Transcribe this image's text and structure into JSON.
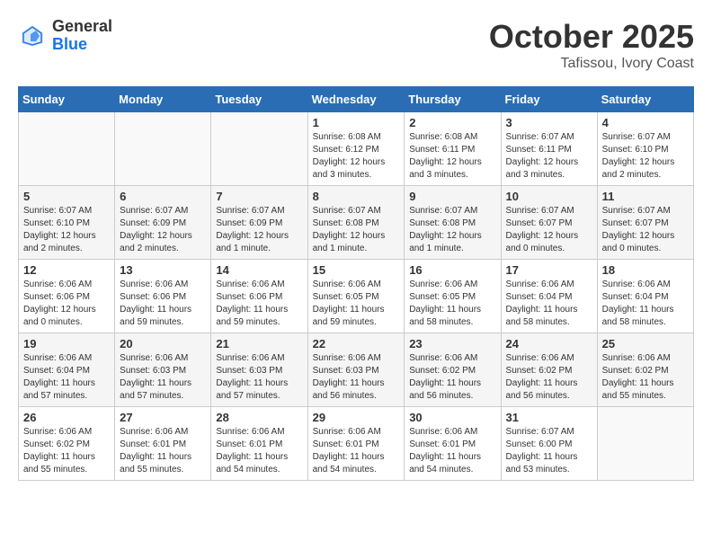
{
  "header": {
    "logo_general": "General",
    "logo_blue": "Blue",
    "month": "October 2025",
    "location": "Tafissou, Ivory Coast"
  },
  "days_of_week": [
    "Sunday",
    "Monday",
    "Tuesday",
    "Wednesday",
    "Thursday",
    "Friday",
    "Saturday"
  ],
  "weeks": [
    [
      {
        "day": "",
        "info": ""
      },
      {
        "day": "",
        "info": ""
      },
      {
        "day": "",
        "info": ""
      },
      {
        "day": "1",
        "info": "Sunrise: 6:08 AM\nSunset: 6:12 PM\nDaylight: 12 hours\nand 3 minutes."
      },
      {
        "day": "2",
        "info": "Sunrise: 6:08 AM\nSunset: 6:11 PM\nDaylight: 12 hours\nand 3 minutes."
      },
      {
        "day": "3",
        "info": "Sunrise: 6:07 AM\nSunset: 6:11 PM\nDaylight: 12 hours\nand 3 minutes."
      },
      {
        "day": "4",
        "info": "Sunrise: 6:07 AM\nSunset: 6:10 PM\nDaylight: 12 hours\nand 2 minutes."
      }
    ],
    [
      {
        "day": "5",
        "info": "Sunrise: 6:07 AM\nSunset: 6:10 PM\nDaylight: 12 hours\nand 2 minutes."
      },
      {
        "day": "6",
        "info": "Sunrise: 6:07 AM\nSunset: 6:09 PM\nDaylight: 12 hours\nand 2 minutes."
      },
      {
        "day": "7",
        "info": "Sunrise: 6:07 AM\nSunset: 6:09 PM\nDaylight: 12 hours\nand 1 minute."
      },
      {
        "day": "8",
        "info": "Sunrise: 6:07 AM\nSunset: 6:08 PM\nDaylight: 12 hours\nand 1 minute."
      },
      {
        "day": "9",
        "info": "Sunrise: 6:07 AM\nSunset: 6:08 PM\nDaylight: 12 hours\nand 1 minute."
      },
      {
        "day": "10",
        "info": "Sunrise: 6:07 AM\nSunset: 6:07 PM\nDaylight: 12 hours\nand 0 minutes."
      },
      {
        "day": "11",
        "info": "Sunrise: 6:07 AM\nSunset: 6:07 PM\nDaylight: 12 hours\nand 0 minutes."
      }
    ],
    [
      {
        "day": "12",
        "info": "Sunrise: 6:06 AM\nSunset: 6:06 PM\nDaylight: 12 hours\nand 0 minutes."
      },
      {
        "day": "13",
        "info": "Sunrise: 6:06 AM\nSunset: 6:06 PM\nDaylight: 11 hours\nand 59 minutes."
      },
      {
        "day": "14",
        "info": "Sunrise: 6:06 AM\nSunset: 6:06 PM\nDaylight: 11 hours\nand 59 minutes."
      },
      {
        "day": "15",
        "info": "Sunrise: 6:06 AM\nSunset: 6:05 PM\nDaylight: 11 hours\nand 59 minutes."
      },
      {
        "day": "16",
        "info": "Sunrise: 6:06 AM\nSunset: 6:05 PM\nDaylight: 11 hours\nand 58 minutes."
      },
      {
        "day": "17",
        "info": "Sunrise: 6:06 AM\nSunset: 6:04 PM\nDaylight: 11 hours\nand 58 minutes."
      },
      {
        "day": "18",
        "info": "Sunrise: 6:06 AM\nSunset: 6:04 PM\nDaylight: 11 hours\nand 58 minutes."
      }
    ],
    [
      {
        "day": "19",
        "info": "Sunrise: 6:06 AM\nSunset: 6:04 PM\nDaylight: 11 hours\nand 57 minutes."
      },
      {
        "day": "20",
        "info": "Sunrise: 6:06 AM\nSunset: 6:03 PM\nDaylight: 11 hours\nand 57 minutes."
      },
      {
        "day": "21",
        "info": "Sunrise: 6:06 AM\nSunset: 6:03 PM\nDaylight: 11 hours\nand 57 minutes."
      },
      {
        "day": "22",
        "info": "Sunrise: 6:06 AM\nSunset: 6:03 PM\nDaylight: 11 hours\nand 56 minutes."
      },
      {
        "day": "23",
        "info": "Sunrise: 6:06 AM\nSunset: 6:02 PM\nDaylight: 11 hours\nand 56 minutes."
      },
      {
        "day": "24",
        "info": "Sunrise: 6:06 AM\nSunset: 6:02 PM\nDaylight: 11 hours\nand 56 minutes."
      },
      {
        "day": "25",
        "info": "Sunrise: 6:06 AM\nSunset: 6:02 PM\nDaylight: 11 hours\nand 55 minutes."
      }
    ],
    [
      {
        "day": "26",
        "info": "Sunrise: 6:06 AM\nSunset: 6:02 PM\nDaylight: 11 hours\nand 55 minutes."
      },
      {
        "day": "27",
        "info": "Sunrise: 6:06 AM\nSunset: 6:01 PM\nDaylight: 11 hours\nand 55 minutes."
      },
      {
        "day": "28",
        "info": "Sunrise: 6:06 AM\nSunset: 6:01 PM\nDaylight: 11 hours\nand 54 minutes."
      },
      {
        "day": "29",
        "info": "Sunrise: 6:06 AM\nSunset: 6:01 PM\nDaylight: 11 hours\nand 54 minutes."
      },
      {
        "day": "30",
        "info": "Sunrise: 6:06 AM\nSunset: 6:01 PM\nDaylight: 11 hours\nand 54 minutes."
      },
      {
        "day": "31",
        "info": "Sunrise: 6:07 AM\nSunset: 6:00 PM\nDaylight: 11 hours\nand 53 minutes."
      },
      {
        "day": "",
        "info": ""
      }
    ]
  ]
}
